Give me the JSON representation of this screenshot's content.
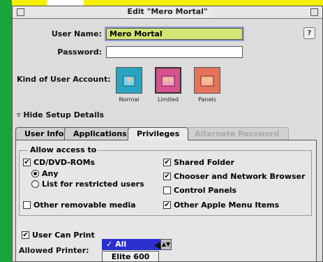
{
  "window": {
    "title": "Edit \"Mero Mortal\""
  },
  "form": {
    "user_name_label": "User Name:",
    "user_name_value": "Mero Mortal",
    "password_label": "Password:",
    "password_value": "",
    "kind_label": "Kind of User Account:"
  },
  "account_types": [
    {
      "label": "Normal",
      "color": "#2aa4c0"
    },
    {
      "label": "Limited",
      "color": "#d7528e"
    },
    {
      "label": "Panels",
      "color": "#e4735a"
    }
  ],
  "setup_toggle": "Hide Setup Details",
  "tabs": [
    {
      "label": "User Info"
    },
    {
      "label": "Applications"
    },
    {
      "label": "Privileges"
    },
    {
      "label": "Alternate Password"
    }
  ],
  "privileges": {
    "group_title": "Allow access to",
    "left": [
      {
        "label": "CD/DVD-ROMs",
        "checked": true
      },
      {
        "label": "Any",
        "selected": true
      },
      {
        "label": "List for restricted users",
        "selected": false
      },
      {
        "label": "Other removable media",
        "checked": false
      }
    ],
    "right": [
      {
        "label": "Shared Folder",
        "checked": true
      },
      {
        "label": "Chooser and Network Browser",
        "checked": true
      },
      {
        "label": "Control Panels",
        "checked": false
      },
      {
        "label": "Other Apple Menu Items",
        "checked": true
      }
    ],
    "user_can_print": {
      "label": "User Can Print",
      "checked": true
    },
    "allowed_printer_label": "Allowed Printer:",
    "printer_options": [
      "All Printers",
      "Elite 600"
    ]
  }
}
